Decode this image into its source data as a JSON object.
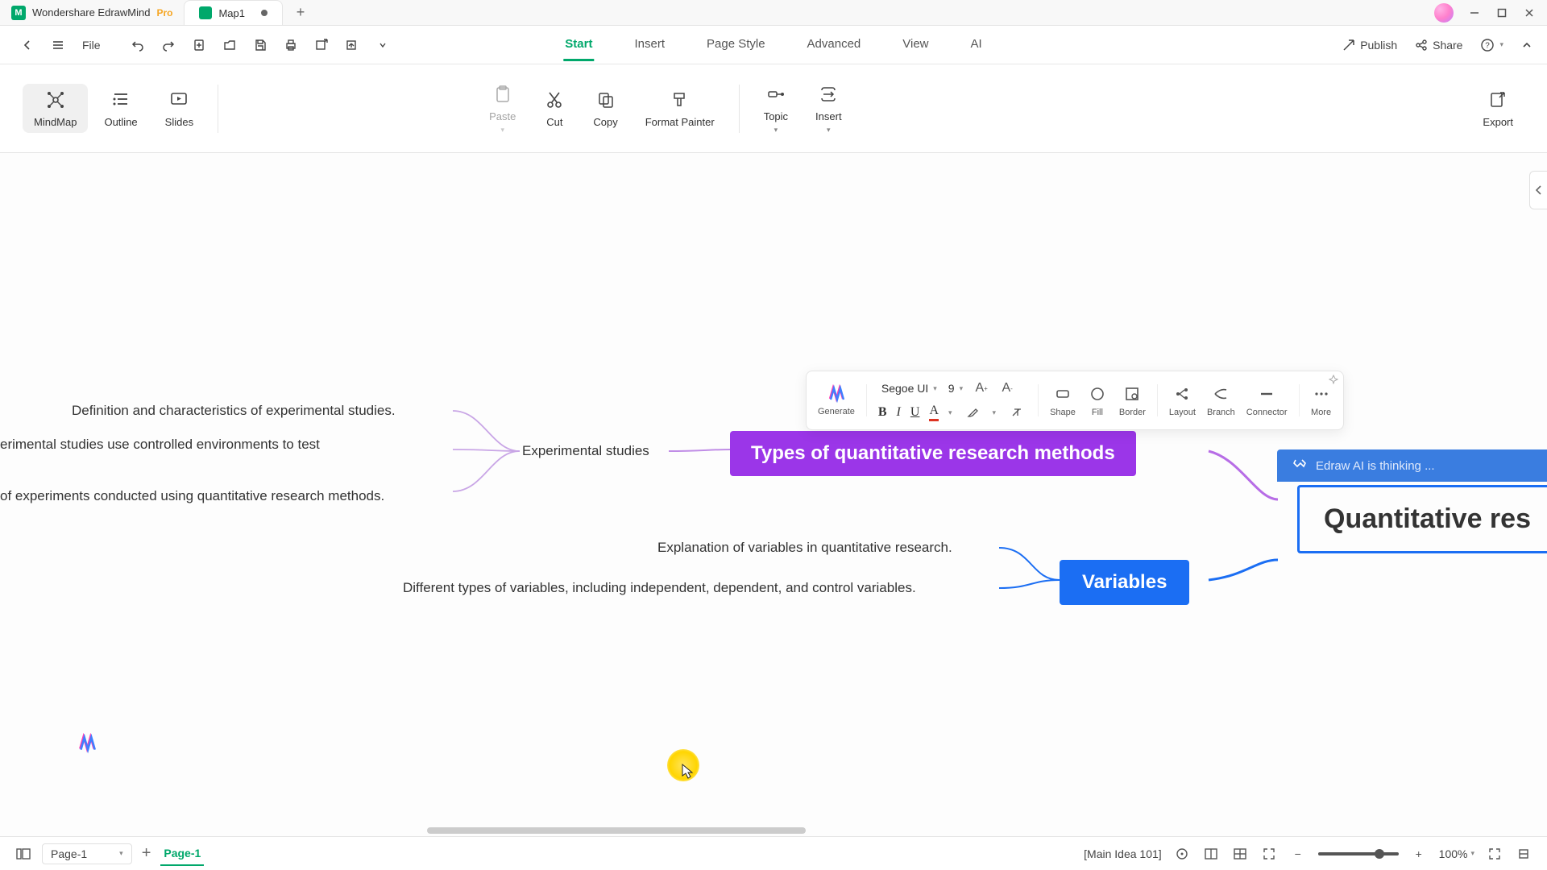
{
  "title": {
    "app_name": "Wondershare EdrawMind",
    "pro": "Pro",
    "doc_name": "Map1"
  },
  "menubar": {
    "file": "File",
    "tabs": {
      "start": "Start",
      "insert": "Insert",
      "page_style": "Page Style",
      "advanced": "Advanced",
      "view": "View",
      "ai": "AI"
    },
    "publish": "Publish",
    "share": "Share"
  },
  "ribbon": {
    "mindmap": "MindMap",
    "outline": "Outline",
    "slides": "Slides",
    "paste": "Paste",
    "cut": "Cut",
    "copy": "Copy",
    "format_painter": "Format Painter",
    "topic": "Topic",
    "insert": "Insert",
    "export": "Export"
  },
  "floatbar": {
    "generate": "Generate",
    "font_name": "Segoe UI",
    "font_size": "9",
    "shape": "Shape",
    "fill": "Fill",
    "border": "Border",
    "layout": "Layout",
    "branch": "Branch",
    "connector": "Connector",
    "more": "More"
  },
  "mindmap": {
    "root_fragment": "Quantitative res",
    "ai_thinking": "Edraw AI is thinking ...",
    "types_node": "Types of quantitative research methods",
    "variables_node": "Variables",
    "exp_studies": "Experimental studies",
    "exp_def": "Definition and characteristics of experimental studies.",
    "exp_env": "erimental studies use controlled environments to test",
    "exp_examples": "of experiments conducted using quantitative research methods.",
    "var_explain": "Explanation of variables in quantitative research.",
    "var_types": "Different types of variables, including independent, dependent, and control variables."
  },
  "status": {
    "page_selector": "Page-1",
    "page_active": "Page-1",
    "context": "[Main Idea 101]",
    "zoom": "100%"
  }
}
